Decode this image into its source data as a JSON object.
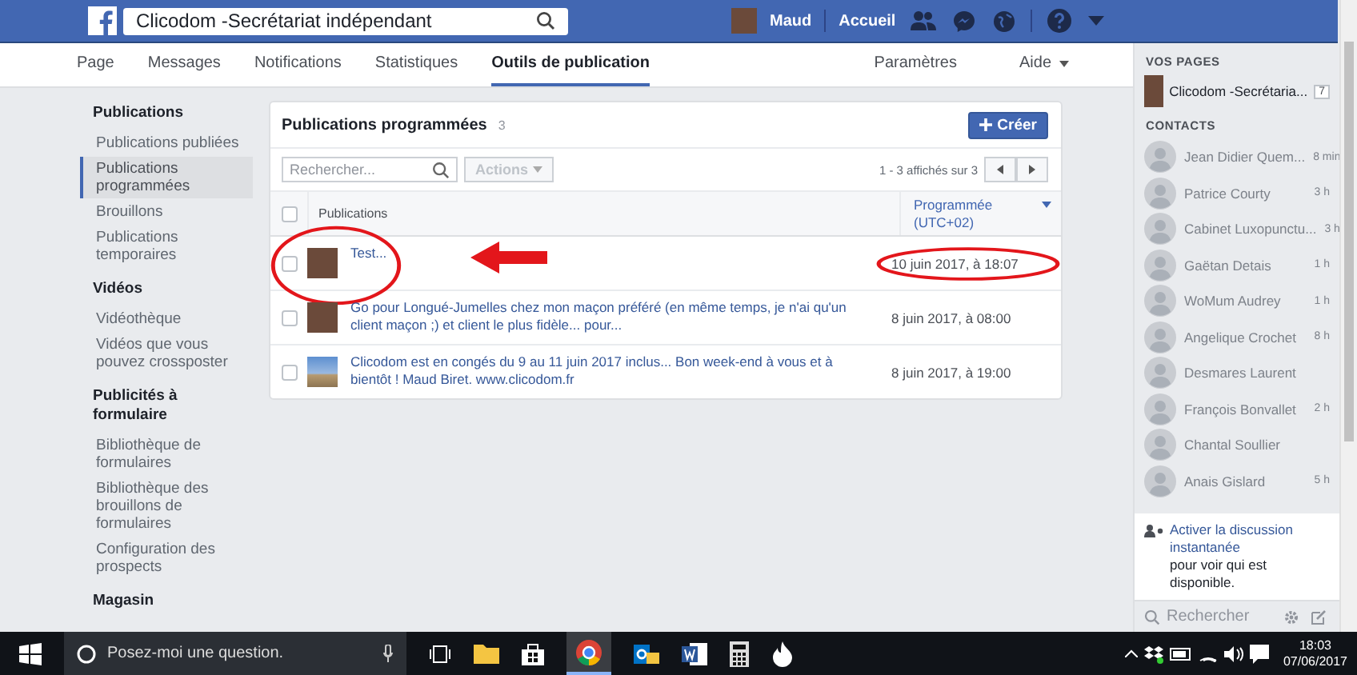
{
  "top_bar": {
    "search_value": "Clicodom -Secrétariat indépendant",
    "user": "Maud",
    "home": "Accueil"
  },
  "tabs": [
    {
      "label": "Page",
      "selected": false
    },
    {
      "label": "Messages",
      "selected": false
    },
    {
      "label": "Notifications",
      "selected": false
    },
    {
      "label": "Statistiques",
      "selected": false
    },
    {
      "label": "Outils de publication",
      "selected": true
    }
  ],
  "tabs_right": [
    {
      "label": "Paramètres",
      "dropdown": false
    },
    {
      "label": "Aide",
      "dropdown": true
    }
  ],
  "sidebar": {
    "sections": [
      {
        "title": "Publications",
        "items": [
          {
            "label": "Publications publiées",
            "selected": false
          },
          {
            "label": "Publications programmées",
            "selected": true
          },
          {
            "label": "Brouillons",
            "selected": false
          },
          {
            "label": "Publications temporaires",
            "selected": false
          }
        ]
      },
      {
        "title": "Vidéos",
        "items": [
          {
            "label": "Vidéothèque",
            "selected": false
          },
          {
            "label": "Vidéos que vous pouvez crossposter",
            "selected": false
          }
        ]
      },
      {
        "title": "Publicités à formulaire",
        "items": [
          {
            "label": "Bibliothèque de formulaires",
            "selected": false
          },
          {
            "label": "Bibliothèque des brouillons de formulaires",
            "selected": false
          },
          {
            "label": "Configuration des prospects",
            "selected": false
          }
        ]
      },
      {
        "title": "Magasin"
      }
    ]
  },
  "panel": {
    "title": "Publications programmées",
    "count": "3",
    "create_button": "Créer",
    "search_placeholder": "Rechercher...",
    "actions_button": "Actions",
    "pagination": "1 - 3 affichés sur 3",
    "table": {
      "header_checked": false,
      "columns": [
        "Publications",
        "Programmée (UTC+02)"
      ],
      "rows": [
        {
          "checked": false,
          "kind": "avatar",
          "text": "Test...",
          "date": "10 juin 2017, à 18:07",
          "highlighted": true
        },
        {
          "checked": false,
          "kind": "avatar",
          "text": "Go pour Longué-Jumelles chez mon maçon préféré (en même temps, je n'ai qu'un client maçon ;) et client le plus fidèle... pour...",
          "date": "8 juin 2017, à 08:00",
          "highlighted": false
        },
        {
          "checked": false,
          "kind": "photo",
          "text": "Clicodom est en congés du 9 au 11 juin 2017 inclus... Bon week-end à vous et à bientôt ! Maud Biret. www.clicodom.fr",
          "date": "8 juin 2017, à 19:00",
          "highlighted": false
        }
      ]
    }
  },
  "chat": {
    "pages_title": "VOS PAGES",
    "page": {
      "name": "Clicodom -Secrétaria...",
      "badge": "7"
    },
    "contacts_title": "CONTACTS",
    "contacts": [
      {
        "name": "Jean Didier Quem...",
        "time": "8 min"
      },
      {
        "name": "Patrice Courty",
        "time": "3 h"
      },
      {
        "name": "Cabinet Luxopunctu...",
        "time": "3 h"
      },
      {
        "name": "Gaëtan Detais",
        "time": "1 h"
      },
      {
        "name": "WoMum Audrey",
        "time": "1 h"
      },
      {
        "name": "Angelique Crochet",
        "time": "8 h"
      },
      {
        "name": "Desmares Laurent"
      },
      {
        "name": "François Bonvallet",
        "time": "2 h"
      },
      {
        "name": "Chantal Soullier"
      },
      {
        "name": "Anais Gislard",
        "time": "5 h"
      }
    ],
    "notice_link": "Activer la discussion instantanée",
    "notice_rest": "pour voir qui est disponible.",
    "search_placeholder": "Rechercher"
  },
  "taskbar": {
    "search_placeholder": "Posez-moi une question.",
    "time": "18:03",
    "date": "07/06/2017"
  }
}
